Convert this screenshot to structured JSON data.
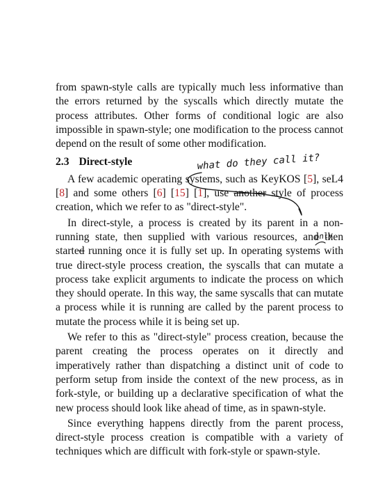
{
  "paragraph_1": "from spawn-style calls are typically much less informative than the errors returned by the syscalls which directly mutate the process attributes. Other forms of conditional logic are also impossible in spawn-style; one modification to the pro­cess cannot depend on the result of some other modification.",
  "section": {
    "number": "2.3",
    "title": "Direct-style"
  },
  "paragraph_2": {
    "part_a": "A few academic operating systems, such as KeyKOS [",
    "cite_1": "5",
    "part_b": "], seL4 [",
    "cite_2": "8",
    "part_c": "] and some others [",
    "cite_3": "6",
    "part_d": "] [",
    "cite_4": "15",
    "part_e": "] [",
    "cite_5": "1",
    "part_f": "], use ",
    "struck_word": "another",
    "part_g": " style of process creation, which we refer to as \"direct-style\"."
  },
  "paragraph_3": {
    "part_a": "In direct-style, a process is created by its parent in a non-running state, then supplied with various resources, and then starte",
    "struck_letter": "d",
    "part_b": " running once it is fully set up. In operating systems with true direct-style process creation, the syscalls that can mutate a process take explicit arguments to indicate the pro­cess on which they should operate. In this way, the same syscalls that can mutate a process while it is running are called by the parent process to mutate the process while it is being set up."
  },
  "paragraph_4": "We refer to this as \"direct-style\" process creation, because the parent creating the process operates on it directly and imperatively rather than dispatching a distinct unit of code to perform setup from inside the context of the new process, as in fork-style, or building up a declarative specification of what the new process should look like ahead of time, as in spawn-style.",
  "paragraph_5": "Since everything happens directly from the parent process, direct-style process creation is compatible with a variety of techniques which are difficult with fork-style or spawn-style.",
  "annotations": {
    "question_note": "what do they call it?",
    "insert_note": "only",
    "ink_color": "#111111"
  }
}
